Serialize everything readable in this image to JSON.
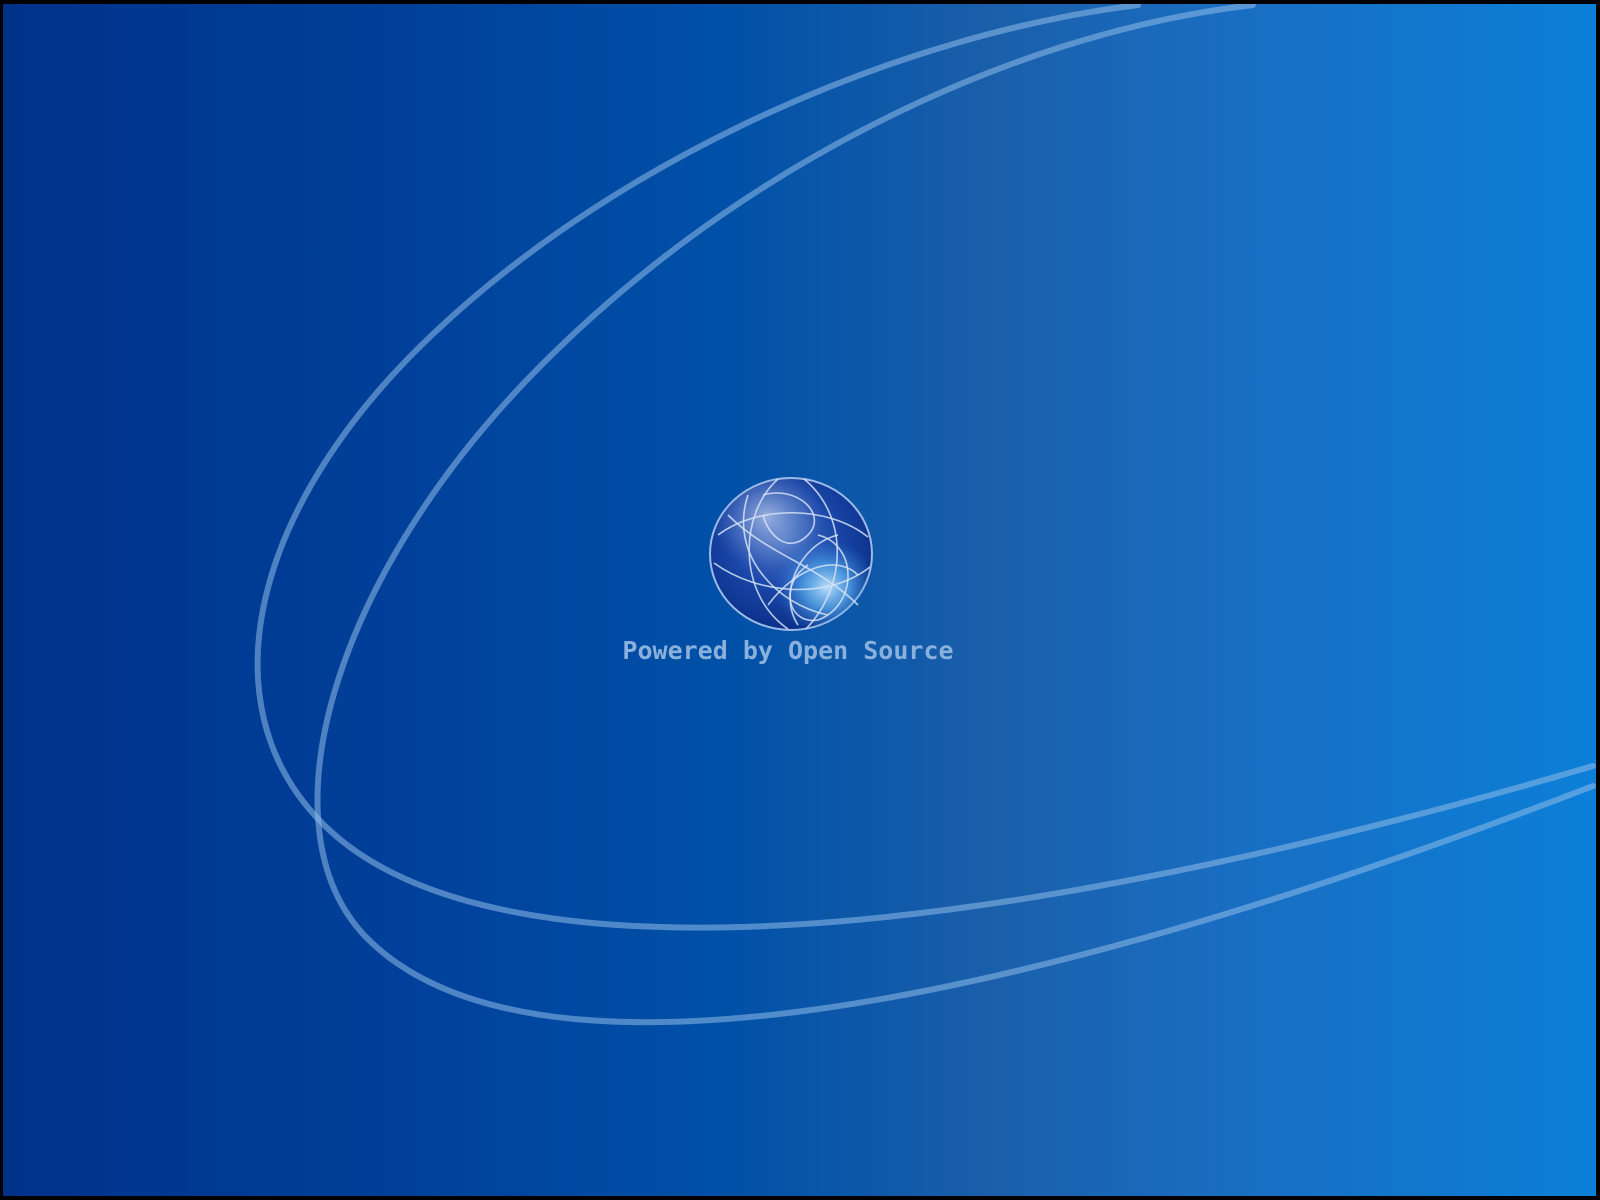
{
  "desktop": {
    "tagline": "Powered by Open Source"
  },
  "icons": {
    "logo": "open-source-globe-icon",
    "decoration": "orbit-swoosh"
  },
  "colors": {
    "background_left": "#00328a",
    "background_right": "#0c7fd8",
    "tagline": "#8ab0dc",
    "swoosh": "#7fb2e6"
  }
}
